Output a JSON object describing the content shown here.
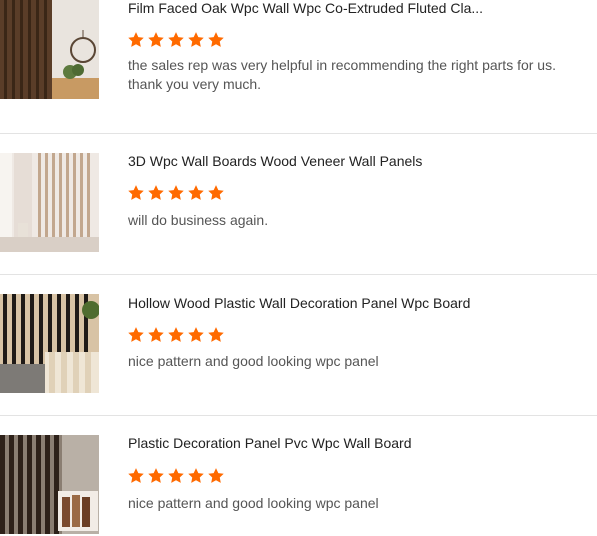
{
  "reviews": [
    {
      "title": "Film Faced Oak Wpc Wall Wpc Co-Extruded Fluted Cla...",
      "rating": 5,
      "text": "the sales rep was very helpful in recommending the right parts for us. thank you very much."
    },
    {
      "title": "3D Wpc Wall Boards Wood Veneer Wall Panels",
      "rating": 5,
      "text": "will do business again."
    },
    {
      "title": "Hollow Wood Plastic Wall Decoration Panel Wpc Board",
      "rating": 5,
      "text": "nice pattern and good looking wpc panel"
    },
    {
      "title": "Plastic Decoration Panel Pvc Wpc Wall Board",
      "rating": 5,
      "text": "nice pattern and good looking wpc panel"
    }
  ],
  "colors": {
    "star": "#ff6a00",
    "divider": "#e3e3e3"
  },
  "icons": {
    "star": "star-icon"
  }
}
